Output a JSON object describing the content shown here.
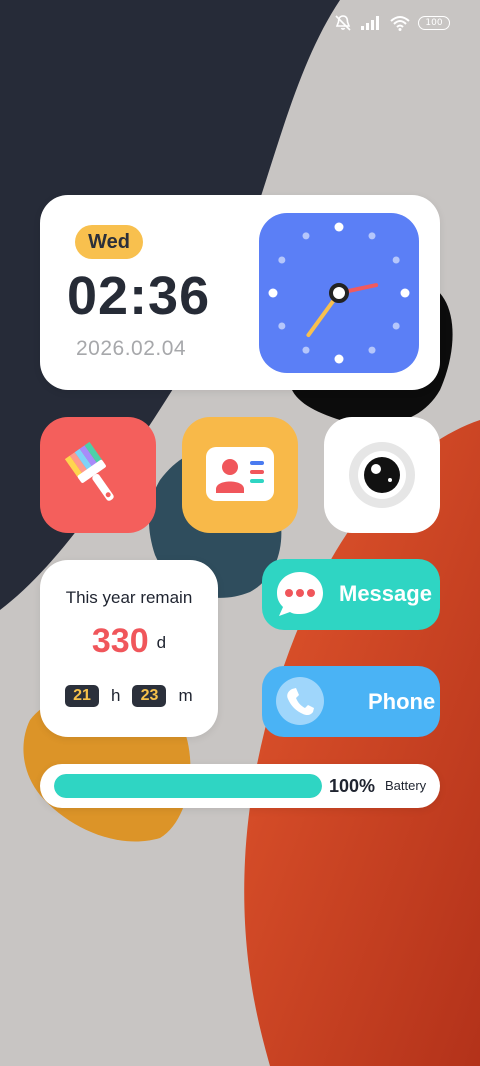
{
  "status_bar": {
    "battery_level": "100",
    "icons": [
      "mute-icon",
      "signal-icon",
      "wifi-icon",
      "battery-icon"
    ]
  },
  "clock_widget": {
    "day": "Wed",
    "time": "02:36",
    "date": "2026.02.04",
    "analog": {
      "hour": 2,
      "minute": 36
    }
  },
  "apps": [
    {
      "name": "brush-app",
      "icon": "paint-brush-icon",
      "color": "#f45f5c"
    },
    {
      "name": "contact-card-app",
      "icon": "id-card-icon",
      "color": "#f8b949"
    },
    {
      "name": "camera-app",
      "icon": "camera-lens-icon",
      "color": "#ffffff"
    }
  ],
  "countdown": {
    "title": "This year remain",
    "days": "330",
    "days_unit": "d",
    "hours": "21",
    "hours_unit": "h",
    "minutes": "23",
    "minutes_unit": "m"
  },
  "message_button": {
    "label": "Message",
    "icon": "chat-bubble-icon",
    "color": "#2fd5c3"
  },
  "phone_button": {
    "label": "Phone",
    "icon": "phone-handset-icon",
    "color": "#4ab3f5"
  },
  "battery_widget": {
    "percent_text": "100%",
    "label": "Battery",
    "fraction": 1.0
  }
}
